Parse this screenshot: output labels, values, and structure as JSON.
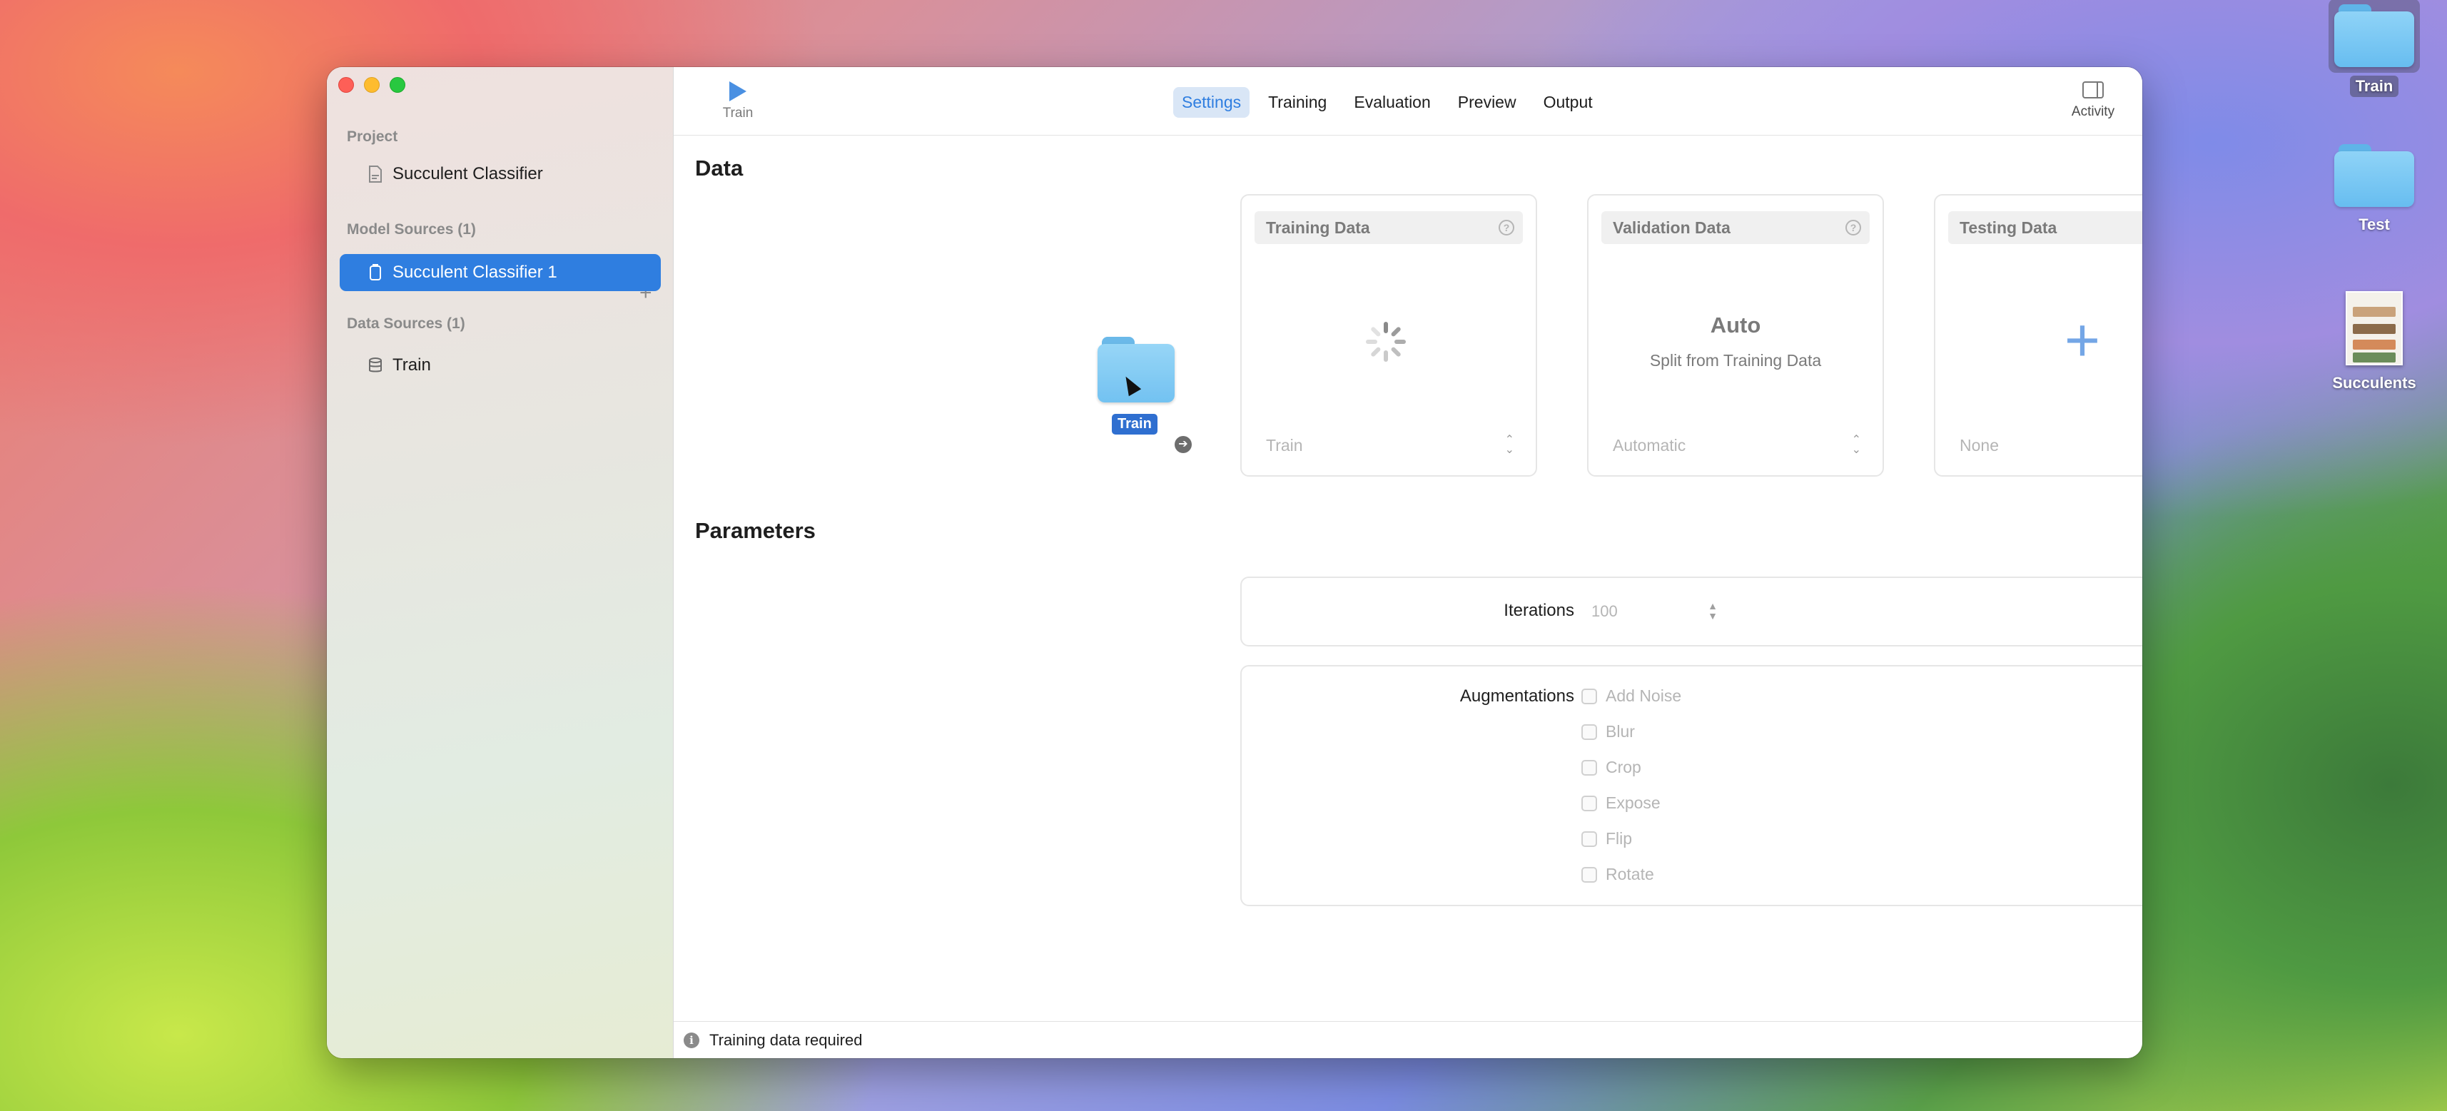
{
  "desktop": {
    "icons": [
      {
        "label": "Train"
      },
      {
        "label": "Test"
      },
      {
        "label": "Succulents"
      }
    ]
  },
  "sidebar": {
    "project_header": "Project",
    "project_name": "Succulent Classifier",
    "model_sources_header": "Model Sources (1)",
    "model_source": "Succulent Classifier 1",
    "data_sources_header": "Data Sources (1)",
    "data_source": "Train"
  },
  "toolbar": {
    "train_label": "Train",
    "tabs": [
      {
        "label": "Settings",
        "active": true
      },
      {
        "label": "Training",
        "active": false
      },
      {
        "label": "Evaluation",
        "active": false
      },
      {
        "label": "Preview",
        "active": false
      },
      {
        "label": "Output",
        "active": false
      }
    ],
    "activity_label": "Activity"
  },
  "data_section": {
    "title": "Data",
    "training": {
      "header": "Training Data",
      "help": "?",
      "select_value": "Train",
      "drag_label": "Train"
    },
    "validation": {
      "header": "Validation Data",
      "help": "?",
      "main_text": "Auto",
      "sub_text": "Split from Training Data",
      "select_value": "Automatic"
    },
    "testing": {
      "header": "Testing Data",
      "help": "?",
      "plus": "+",
      "select_value": "None"
    }
  },
  "parameters": {
    "title": "Parameters",
    "iterations_label": "Iterations",
    "iterations_value": "100",
    "augmentations_label": "Augmentations",
    "augmentations": [
      "Add Noise",
      "Blur",
      "Crop",
      "Expose",
      "Flip",
      "Rotate"
    ]
  },
  "status": {
    "message": "Training data required"
  },
  "colors": {
    "accent": "#2f7ee0",
    "sidebar_selection": "#2f7ee0",
    "tab_active_bg": "#d9e6f6"
  }
}
